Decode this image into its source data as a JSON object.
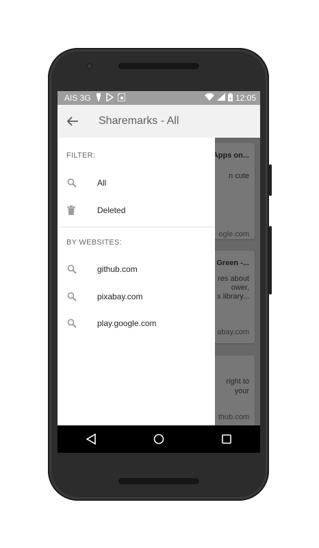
{
  "status_bar": {
    "carrier": "AIS 3G",
    "time": "12:05",
    "left_icons": [
      "usb-icon",
      "play-store-icon",
      "sd-card-icon"
    ],
    "right_icons": [
      "wifi-icon",
      "signal-icon",
      "battery-icon"
    ]
  },
  "app_bar": {
    "title": "Sharemarks - All",
    "back_icon": "arrow-back-icon"
  },
  "drawer": {
    "filter_header": "FILTER:",
    "filter_items": [
      {
        "label": "All",
        "icon": "search-icon"
      },
      {
        "label": "Deleted",
        "icon": "trash-icon"
      }
    ],
    "websites_header": "BY WEBSITES:",
    "website_items": [
      {
        "label": "github.com",
        "icon": "search-icon"
      },
      {
        "label": "pixabay.com",
        "icon": "search-icon"
      },
      {
        "label": "play.google.com",
        "icon": "search-icon"
      }
    ]
  },
  "background_cards": [
    {
      "title": "Apps on...",
      "lines": [
        "n cute"
      ],
      "footer": "ogle.com"
    },
    {
      "title": "Green -...",
      "lines": [
        "res about",
        "ower,",
        "s library..."
      ],
      "footer": "abay.com"
    },
    {
      "title": "",
      "lines": [
        "right to",
        "your"
      ],
      "footer": "thub.com"
    }
  ],
  "nav_bar": {
    "icons": [
      "back-triangle-icon",
      "home-circle-icon",
      "recents-square-icon"
    ]
  }
}
